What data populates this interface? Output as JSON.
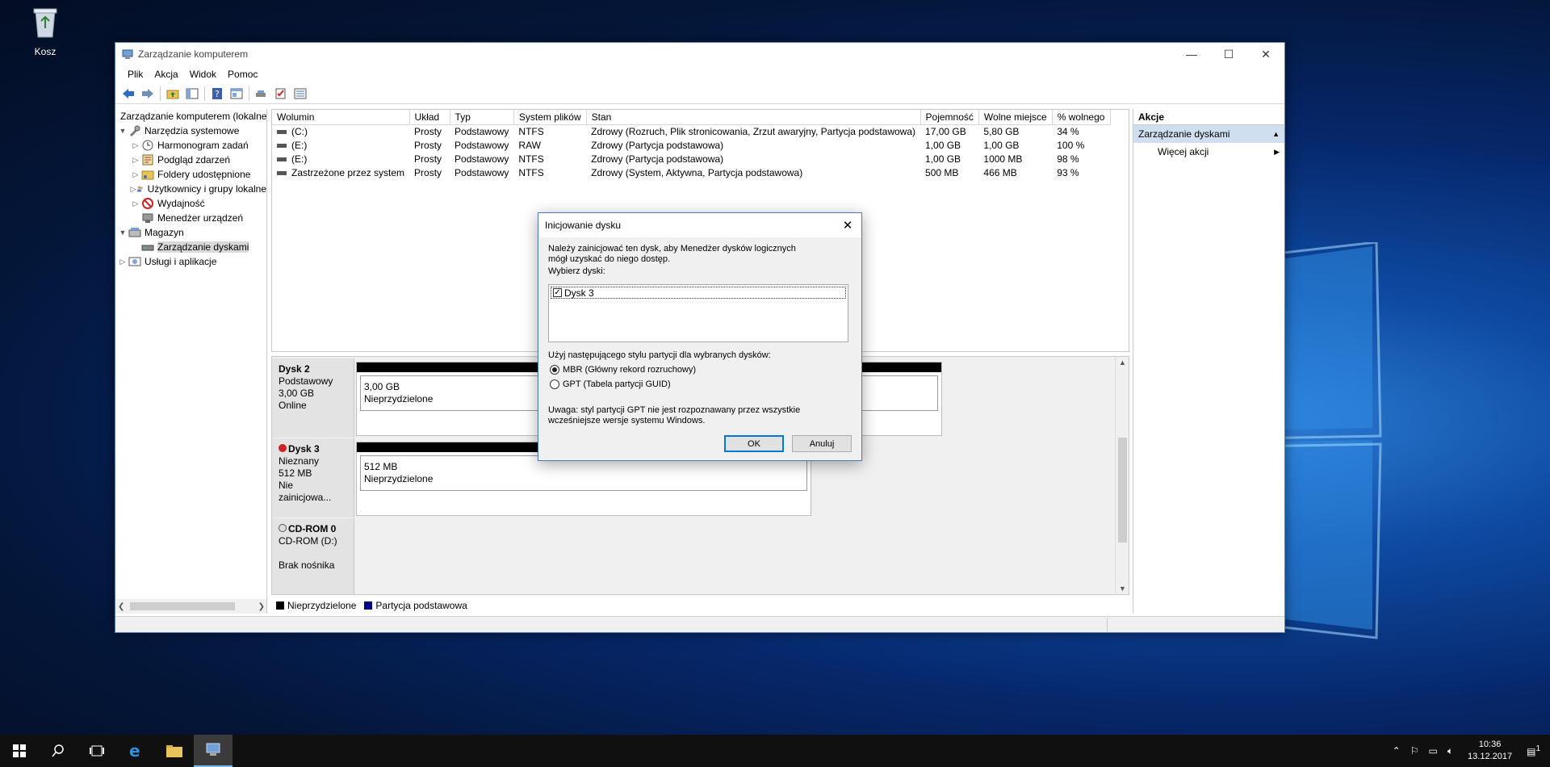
{
  "desktop": {
    "recycle_bin_label": "Kosz"
  },
  "window": {
    "title": "Zarządzanie komputerem",
    "controls": {
      "minimize": "—",
      "maximize": "☐",
      "close": "✕"
    },
    "menu": [
      "Plik",
      "Akcja",
      "Widok",
      "Pomoc"
    ],
    "toolbar_icons": [
      "back-icon",
      "forward-icon",
      "up-folder-icon",
      "show-tree-icon",
      "help-icon",
      "properties-icon",
      "connect-icon",
      "checklist-icon",
      "details-icon"
    ]
  },
  "tree": {
    "root": "Zarządzanie komputerem (lokalne)",
    "items": [
      {
        "label": "Narzędzia systemowe",
        "level": 1,
        "expander": "expanded"
      },
      {
        "label": "Harmonogram zadań",
        "level": 2,
        "expander": "collapsed"
      },
      {
        "label": "Podgląd zdarzeń",
        "level": 2,
        "expander": "collapsed"
      },
      {
        "label": "Foldery udostępnione",
        "level": 2,
        "expander": "collapsed"
      },
      {
        "label": "Użytkownicy i grupy lokalne",
        "level": 2,
        "expander": "collapsed"
      },
      {
        "label": "Wydajność",
        "level": 2,
        "expander": "collapsed"
      },
      {
        "label": "Menedżer urządzeń",
        "level": 2,
        "expander": "none"
      },
      {
        "label": "Magazyn",
        "level": 1,
        "expander": "expanded"
      },
      {
        "label": "Zarządzanie dyskami",
        "level": 2,
        "expander": "none",
        "selected": true
      },
      {
        "label": "Usługi i aplikacje",
        "level": 1,
        "expander": "collapsed"
      }
    ]
  },
  "volumes": {
    "columns": [
      "Wolumin",
      "Układ",
      "Typ",
      "System plików",
      "Stan",
      "Pojemność",
      "Wolne miejsce",
      "% wolnego"
    ],
    "rows": [
      [
        "(C:)",
        "Prosty",
        "Podstawowy",
        "NTFS",
        "Zdrowy (Rozruch, Plik stronicowania, Zrzut awaryjny, Partycja podstawowa)",
        "17,00 GB",
        "5,80 GB",
        "34 %"
      ],
      [
        "(E:)",
        "Prosty",
        "Podstawowy",
        "RAW",
        "Zdrowy (Partycja podstawowa)",
        "1,00 GB",
        "1,00 GB",
        "100 %"
      ],
      [
        "(E:)",
        "Prosty",
        "Podstawowy",
        "NTFS",
        "Zdrowy (Partycja podstawowa)",
        "1,00 GB",
        "1000 MB",
        "98 %"
      ],
      [
        "Zastrzeżone przez system",
        "Prosty",
        "Podstawowy",
        "NTFS",
        "Zdrowy (System, Aktywna, Partycja podstawowa)",
        "500 MB",
        "466 MB",
        "93 %"
      ]
    ]
  },
  "disks": [
    {
      "name": "Dysk 2",
      "type": "Podstawowy",
      "size": "3,00 GB",
      "status": "Online",
      "part_size": "3,00 GB",
      "part_label": "Nieprzydzielone"
    },
    {
      "name": "Dysk 3",
      "type": "Nieznany",
      "size": "512 MB",
      "status": "Nie zainicjowa...",
      "part_size": "512 MB",
      "part_label": "Nieprzydzielone"
    },
    {
      "name": "CD-ROM 0",
      "type": "CD-ROM (D:)",
      "size": "",
      "status": "Brak nośnika"
    }
  ],
  "legend": {
    "unallocated": "Nieprzydzielone",
    "primary": "Partycja podstawowa",
    "colors": {
      "unallocated": "#000000",
      "primary": "#000080"
    }
  },
  "actions": {
    "header": "Akcje",
    "section": "Zarządzanie dyskami",
    "more": "Więcej akcji"
  },
  "dialog": {
    "title": "Inicjowanie dysku",
    "intro": "Należy zainicjować ten dysk, aby Menedżer dysków logicznych mógł uzyskać do niego dostęp.",
    "select_label": "Wybierz dyski:",
    "disk_item": "Dysk 3",
    "disk_checked": true,
    "style_label": "Użyj następującego stylu partycji dla wybranych dysków:",
    "options": [
      "MBR (Główny rekord rozruchowy)",
      "GPT (Tabela partycji GUID)"
    ],
    "selected_option": 0,
    "note": "Uwaga: styl partycji GPT nie jest rozpoznawany przez wszystkie wcześniejsze wersje systemu Windows.",
    "ok": "OK",
    "cancel": "Anuluj"
  },
  "taskbar": {
    "time": "10:36",
    "date": "13.12.2017",
    "notification_count": "1"
  }
}
